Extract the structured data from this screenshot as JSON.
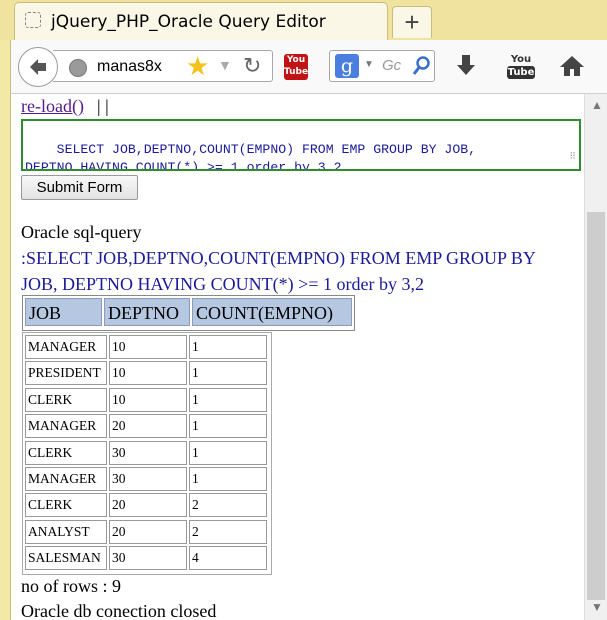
{
  "tab": {
    "title": "jQuery_PHP_Oracle Query Editor",
    "new_tab_label": "+"
  },
  "toolbar": {
    "url": "manas8x",
    "search_placeholder": "Gc",
    "youtube_small": "You Tube",
    "youtube_big_top": "You",
    "youtube_big_bottom": "Tube"
  },
  "page": {
    "reload_link": "re-load()",
    "separator": "| |",
    "query_text": "SELECT JOB,DEPTNO,COUNT(EMPNO) FROM EMP GROUP BY JOB,\nDEPTNO HAVING COUNT(*) >= 1 order by 3,2",
    "submit_label": "Submit Form",
    "sql_heading": "Oracle sql-query",
    "sql_echo": ":SELECT JOB,DEPTNO,COUNT(EMPNO) FROM EMP GROUP BY JOB, DEPTNO HAVING COUNT(*) >= 1 order by 3,2",
    "row_count": "no of rows : 9",
    "connection_closed": "Oracle db conection closed"
  },
  "table": {
    "headers": [
      "JOB",
      "DEPTNO",
      "COUNT(EMPNO)"
    ],
    "rows": [
      [
        "MANAGER",
        "10",
        "1"
      ],
      [
        "PRESIDENT",
        "10",
        "1"
      ],
      [
        "CLERK",
        "10",
        "1"
      ],
      [
        "MANAGER",
        "20",
        "1"
      ],
      [
        "CLERK",
        "30",
        "1"
      ],
      [
        "MANAGER",
        "30",
        "1"
      ],
      [
        "CLERK",
        "20",
        "2"
      ],
      [
        "ANALYST",
        "20",
        "2"
      ],
      [
        "SALESMAN",
        "30",
        "4"
      ]
    ]
  }
}
